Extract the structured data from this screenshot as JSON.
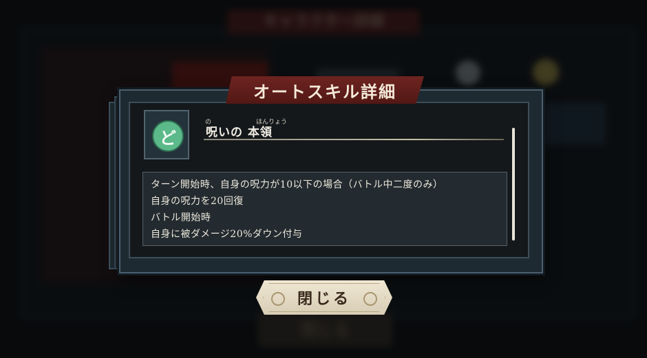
{
  "background": {
    "title": "キャラクター詳細",
    "button_label": "閉じる"
  },
  "dialog": {
    "title": "オートスキル詳細",
    "skill": {
      "icon": "curse-skill-icon",
      "ruby_1": "のろ",
      "ruby_2": "ほんりょう",
      "name": "呪いの 本領"
    },
    "description": [
      "ターン開始時、自身の呪力が10以下の場合（バトル中二度のみ）",
      "自身の呪力を20回復",
      "バトル開始時",
      "自身に被ダメージ20%ダウン付与"
    ],
    "close_label": "閉じる"
  },
  "colors": {
    "banner": "#6e2420",
    "skill_icon": "#5bb98a",
    "button": "#efe7d3"
  }
}
